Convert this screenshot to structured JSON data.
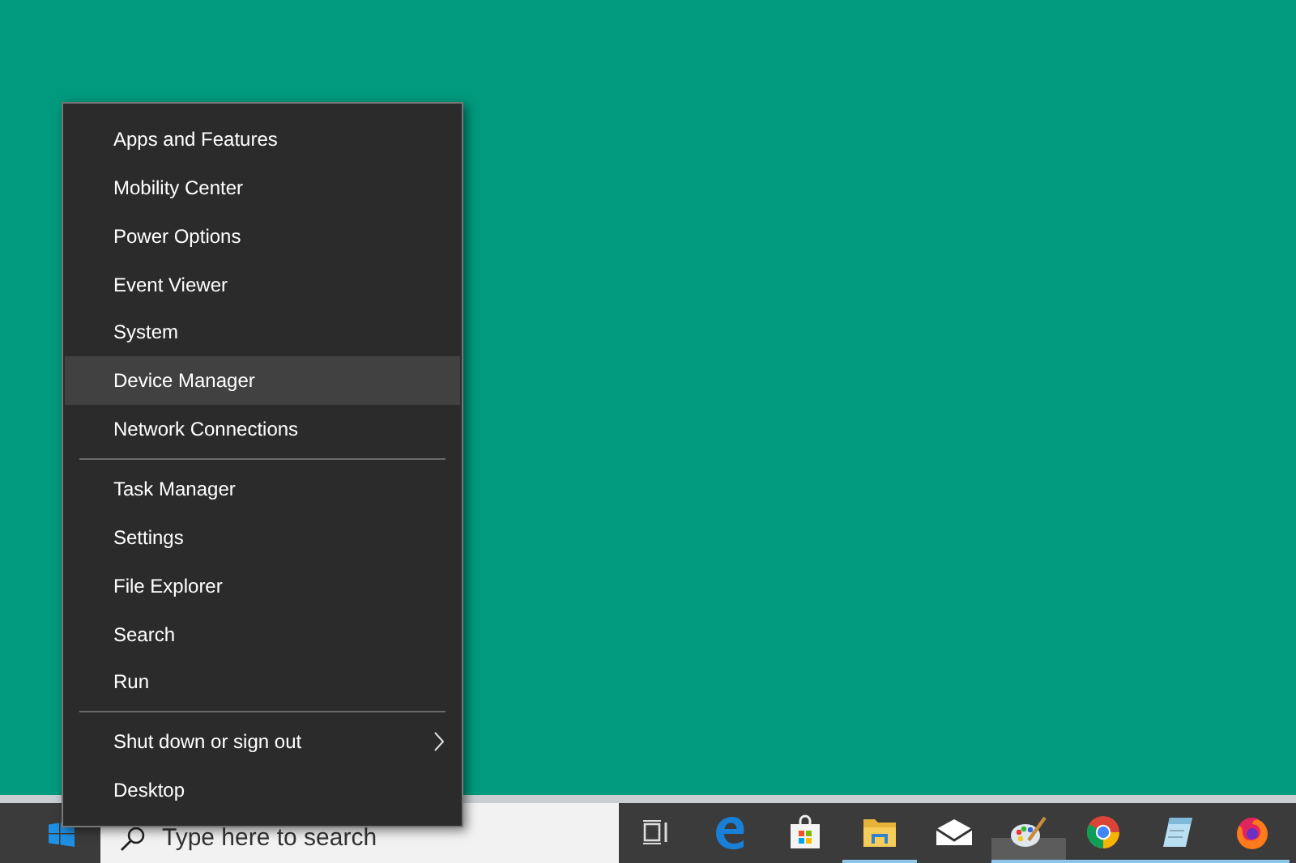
{
  "context_menu": {
    "items": [
      {
        "kind": "item",
        "label": "Apps and Features",
        "selected": false,
        "submenu": false
      },
      {
        "kind": "item",
        "label": "Mobility Center",
        "selected": false,
        "submenu": false
      },
      {
        "kind": "item",
        "label": "Power Options",
        "selected": false,
        "submenu": false
      },
      {
        "kind": "item",
        "label": "Event Viewer",
        "selected": false,
        "submenu": false
      },
      {
        "kind": "item",
        "label": "System",
        "selected": false,
        "submenu": false
      },
      {
        "kind": "item",
        "label": "Device Manager",
        "selected": true,
        "submenu": false
      },
      {
        "kind": "item",
        "label": "Network Connections",
        "selected": false,
        "submenu": false
      },
      {
        "kind": "separator"
      },
      {
        "kind": "item",
        "label": "Task Manager",
        "selected": false,
        "submenu": false
      },
      {
        "kind": "item",
        "label": "Settings",
        "selected": false,
        "submenu": false
      },
      {
        "kind": "item",
        "label": "File Explorer",
        "selected": false,
        "submenu": false
      },
      {
        "kind": "item",
        "label": "Search",
        "selected": false,
        "submenu": false
      },
      {
        "kind": "item",
        "label": "Run",
        "selected": false,
        "submenu": false
      },
      {
        "kind": "separator"
      },
      {
        "kind": "item",
        "label": "Shut down or sign out",
        "selected": false,
        "submenu": true
      },
      {
        "kind": "item",
        "label": "Desktop",
        "selected": false,
        "submenu": false
      }
    ]
  },
  "taskbar": {
    "search": {
      "placeholder": "Type here to search"
    },
    "buttons": [
      {
        "kind": "taskview",
        "running": false,
        "selected": false
      },
      {
        "kind": "edge",
        "running": false,
        "selected": false
      },
      {
        "kind": "store",
        "running": false,
        "selected": false
      },
      {
        "kind": "folder",
        "running": true,
        "selected": false
      },
      {
        "kind": "mail",
        "running": false,
        "selected": false
      },
      {
        "kind": "paint",
        "running": true,
        "selected": true
      },
      {
        "kind": "chrome",
        "running": true,
        "selected": false
      },
      {
        "kind": "notepad",
        "running": true,
        "selected": false
      },
      {
        "kind": "firefox",
        "running": true,
        "selected": false
      }
    ]
  }
}
